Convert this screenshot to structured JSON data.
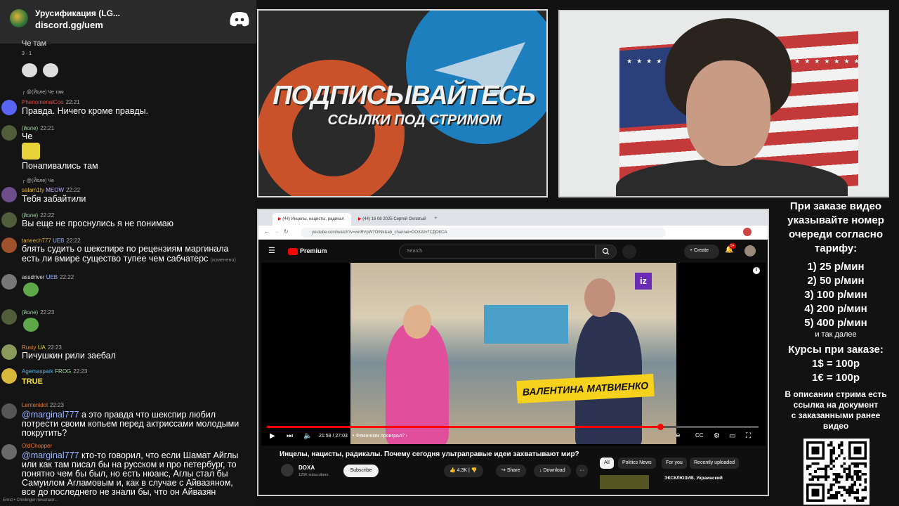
{
  "discord": {
    "title": "Урусификация (LG...",
    "url": "discord.gg/uem"
  },
  "chat": {
    "messages": [
      {
        "text": "Че там",
        "reactions": "3 · 1"
      },
      {
        "reply": "@(Йоле) Че там",
        "user": "PhenomenalCoo",
        "time": "22:21",
        "text": "Правда. Ничего кроме правды."
      },
      {
        "user": "(йоле)",
        "time": "22:21",
        "text": "Че"
      },
      {
        "text": "Понапивались там"
      },
      {
        "reply": "@(Йоле) Че",
        "user": "salam1ty",
        "badge": "MEOW",
        "time": "22:22",
        "text": "Тебя забайтили"
      },
      {
        "user": "(йоле)",
        "time": "22:22",
        "text": "Вы еще не проснулись я не понимаю"
      },
      {
        "user": "taneech777",
        "badge": "UEB",
        "time": "22:22",
        "text": "блять судить о шекспире по рецензиям маргинала",
        "text2": "есть ли вмире существо тупее чем сабчатерс",
        "edited": "(изменено)"
      },
      {
        "user": "assdriver",
        "badge": "UEB",
        "time": "22:22"
      },
      {
        "user": "(йоле)",
        "time": "22:23"
      },
      {
        "user": "Rusty",
        "badge": "UA",
        "time": "22:23",
        "text": "Пичушкин рили заебал"
      },
      {
        "user": "Agemaspark",
        "badge": "FROG",
        "time": "22:23",
        "emote": "TRUE"
      },
      {
        "user": "Lentenidol",
        "time": "22:23",
        "mention": "@marginal777",
        "text": " а это правда что шекспир любил",
        "text2": "потрести своим копьем перед актриссами молодыми",
        "text3": "покрутить?"
      },
      {
        "user": "OldChopper",
        "mention": "@marginal777",
        "text": " кто-то говорил, что если Шамат Айглы",
        "text2": "или как там писал бы на русском и про петербург, то",
        "text3": "понятно чем бы был, но есть нюанс, Аглы стал бы",
        "text4": "Самуилом Агламовым и, как в случае с Айвазяном,",
        "text5": "все до последнего не знали бы, что он Айвазян"
      },
      {
        "footer": "Ernst • Chinlinger печатают..."
      }
    ]
  },
  "banner": {
    "title": "ПОДПИСЫВАЙТЕСЬ",
    "subtitle": "ССЫЛКИ ПОД СТРИМОМ"
  },
  "browser": {
    "tabs": [
      "(44) Инцелы, нацисты, радикал",
      "(44) 16 08 2025 Сергей Охлатый"
    ],
    "url": "youtube.com/watch?v=wnRVpW7OINk&ab_channel=DOXA%7CДОКСА",
    "yt_logo": "Premium",
    "search_placeholder": "Search",
    "create_label": "+ Create",
    "notif_badge": "9+",
    "iz_logo": "iz",
    "name_plate": "ВАЛЕНТИНА МАТВИЕНКО",
    "progress_fraction": 0.8,
    "time": "21:59 / 27:03",
    "chapter": "• Феминизм проиграл? ›",
    "video_title": "Инцелы, нацисты, радикалы. Почему сегодня ультраправые идеи захватывают мир?",
    "channel": "DOXA",
    "subs": "125K subscribers",
    "subscribe": "Subscribe",
    "likes": "4.3K",
    "share": "Share",
    "download": "Download",
    "more": "···",
    "chips": [
      "All",
      "Politics News",
      "For you",
      "Recently uploaded"
    ],
    "rec_title": "ЭКСКЛЮЗИВ. Украинский"
  },
  "info": {
    "head": [
      "При заказе видео",
      "указывайте номер",
      "очереди согласно",
      "тарифу:"
    ],
    "prices": [
      "1) 25 р/мин",
      "2) 50 р/мин",
      "3) 100 р/мин",
      "4) 200 р/мин",
      "5) 400 р/мин"
    ],
    "etc": "и так далее",
    "courses": [
      "Курсы при заказе:",
      "1$ = 100р",
      "1€ = 100р"
    ],
    "desc": [
      "В описании стрима есть",
      "ссылка на документ",
      "с заказанными ранее",
      "видео"
    ]
  }
}
